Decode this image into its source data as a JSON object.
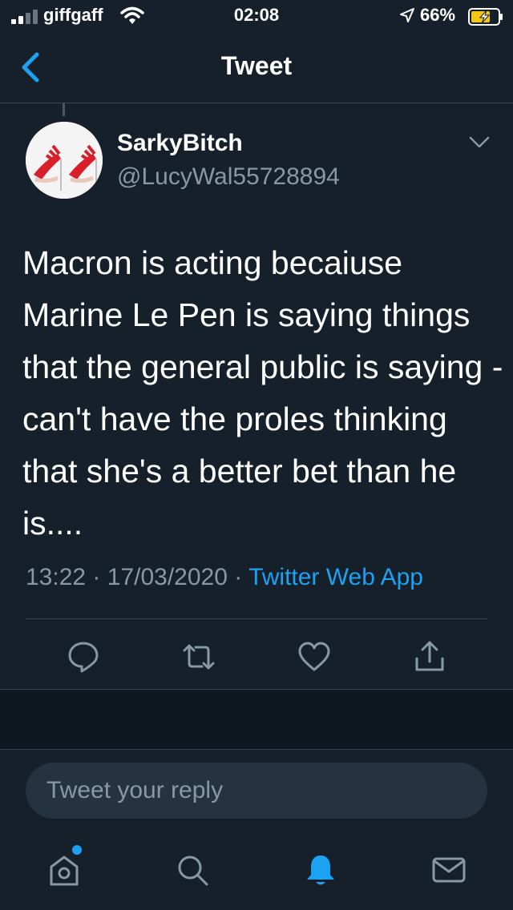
{
  "status_bar": {
    "carrier": "giffgaff",
    "time": "02:08",
    "battery_percent": "66%",
    "icons": [
      "signal-icon",
      "wifi-icon",
      "location-icon",
      "battery-charging-icon"
    ]
  },
  "nav": {
    "title": "Tweet",
    "back_icon": "chevron-left-icon"
  },
  "tweet": {
    "display_name": "SarkyBitch",
    "handle": "@LucyWal55728894",
    "text": "Macron is acting becaiuse Marine Le Pen is saying things that the general public is saying - can't have the proles thinking that she's a better bet than he is....",
    "time": "13:22",
    "separator": "·",
    "date": "17/03/2020",
    "source": "Twitter Web App",
    "menu_icon": "chevron-down-icon",
    "actions": [
      "reply-icon",
      "retweet-icon",
      "like-icon",
      "share-icon"
    ]
  },
  "reply": {
    "placeholder": "Tweet your reply"
  },
  "tab_bar": {
    "tabs": [
      "home-icon",
      "search-icon",
      "notifications-icon",
      "messages-icon"
    ],
    "active": "notifications-icon"
  },
  "colors": {
    "background": "#15202b",
    "accent": "#1da1f2",
    "secondary_text": "#8899a6",
    "divider": "#38444d"
  }
}
